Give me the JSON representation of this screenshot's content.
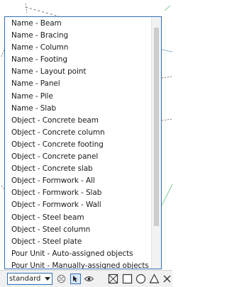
{
  "dropdown": {
    "items": [
      "Name - Beam",
      "Name - Bracing",
      "Name - Column",
      "Name - Footing",
      "Name - Layout point",
      "Name - Panel",
      "Name - Pile",
      "Name - Slab",
      "Object - Concrete beam",
      "Object - Concrete column",
      "Object - Concrete footing",
      "Object - Concrete panel",
      "Object - Concrete slab",
      "Object - Formwork - All",
      "Object - Formwork - Slab",
      "Object - Formwork - Wall",
      "Object - Steel beam",
      "Object - Steel column",
      "Object - Steel plate",
      "Pour Unit - Auto-assigned objects",
      "Pour Unit - Manually-assigned objects"
    ],
    "scroll_position": 0.2
  },
  "toolbar": {
    "filter_select_value": "standard",
    "icons": [
      "selection-filter-icon",
      "select-pointer-icon",
      "visibility-eye-icon",
      "box-x-icon",
      "rectangle-icon",
      "circle-icon",
      "triangle-icon",
      "close-x-icon"
    ]
  },
  "colors": {
    "accent_border": "#2f6fb5",
    "background_line_green": "#4fbf6f",
    "background_line_blue": "#2f6fb5"
  }
}
